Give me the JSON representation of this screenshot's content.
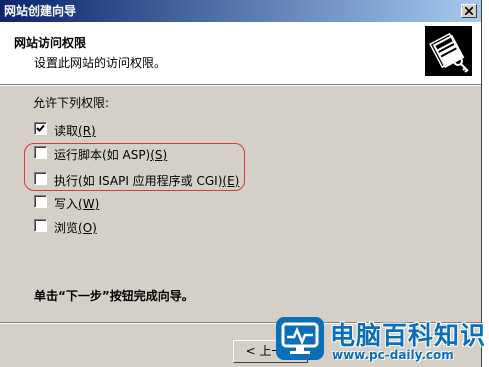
{
  "window": {
    "title": "网站创建向导"
  },
  "header": {
    "title": "网站访问权限",
    "subtitle": "设置此网站的访问权限。",
    "icon": "wizard-book-key-icon"
  },
  "permissions": {
    "group_label": "允许下列权限:",
    "options": [
      {
        "text": "读取",
        "mnemonic": "(R)",
        "checked": true
      },
      {
        "text": "运行脚本(如 ASP)",
        "mnemonic": "(S)",
        "checked": false
      },
      {
        "text": "执行(如 ISAPI 应用程序或 CGI)",
        "mnemonic": "(E)",
        "checked": false
      },
      {
        "text": "写入",
        "mnemonic": "(W)",
        "checked": false
      },
      {
        "text": "浏览",
        "mnemonic": "(O)",
        "checked": false
      }
    ]
  },
  "footer": {
    "instruction": "单击“下一步”按钮完成向导。",
    "back_label": "< 上一步"
  },
  "annotation": {
    "highlight_color": "#d83a3a"
  },
  "watermark": {
    "title": "电脑百科知识",
    "url": "www.pc-daily.com",
    "brand_color": "#0b6fb8"
  }
}
